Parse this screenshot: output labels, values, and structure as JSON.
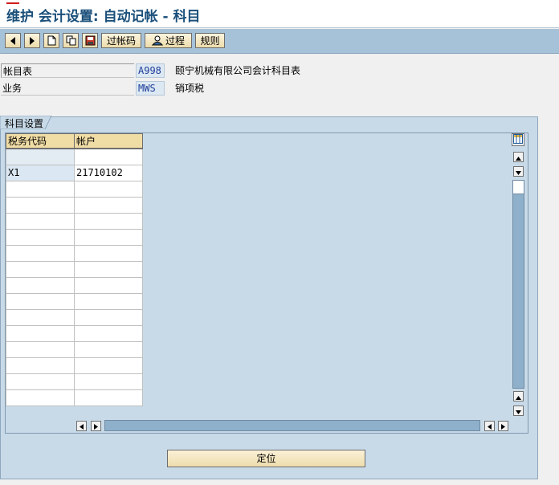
{
  "window": {
    "title": "维护 会计设置: 自动记帐 - 科目"
  },
  "toolbar": {
    "buttons": [
      {
        "icon": "triangle-left-icon"
      },
      {
        "icon": "triangle-right-icon"
      },
      {
        "icon": "new-page-icon"
      },
      {
        "icon": "copy-icon"
      },
      {
        "icon": "save-icon"
      },
      {
        "label": "过帐码"
      },
      {
        "icon": "user-icon",
        "label": "过程"
      },
      {
        "label": "规则"
      }
    ]
  },
  "form": {
    "chart_of_accounts": {
      "label": "帐目表",
      "value": "A998",
      "description": "颐宁机械有限公司会计科目表"
    },
    "transaction": {
      "label": "业务",
      "value": "MWS",
      "description": "销项税"
    }
  },
  "group": {
    "title": "科目设置"
  },
  "table": {
    "columns": [
      "税务代码",
      "帐户"
    ],
    "rows": [
      [
        "",
        ""
      ],
      [
        "X1",
        "21710102"
      ],
      [
        "",
        ""
      ],
      [
        "",
        ""
      ],
      [
        "",
        ""
      ],
      [
        "",
        ""
      ],
      [
        "",
        ""
      ],
      [
        "",
        ""
      ],
      [
        "",
        ""
      ],
      [
        "",
        ""
      ],
      [
        "",
        ""
      ],
      [
        "",
        ""
      ],
      [
        "",
        ""
      ],
      [
        "",
        ""
      ],
      [
        "",
        ""
      ],
      [
        "",
        ""
      ]
    ]
  },
  "actions": {
    "locate_label": "定位"
  },
  "colors": {
    "toolbar_bg": "#a6c2d9",
    "group_bg": "#c8dae8",
    "header_bg": "#f0dca5",
    "title_color": "#1a4f7a",
    "key_value_color": "#1f3e9a"
  }
}
